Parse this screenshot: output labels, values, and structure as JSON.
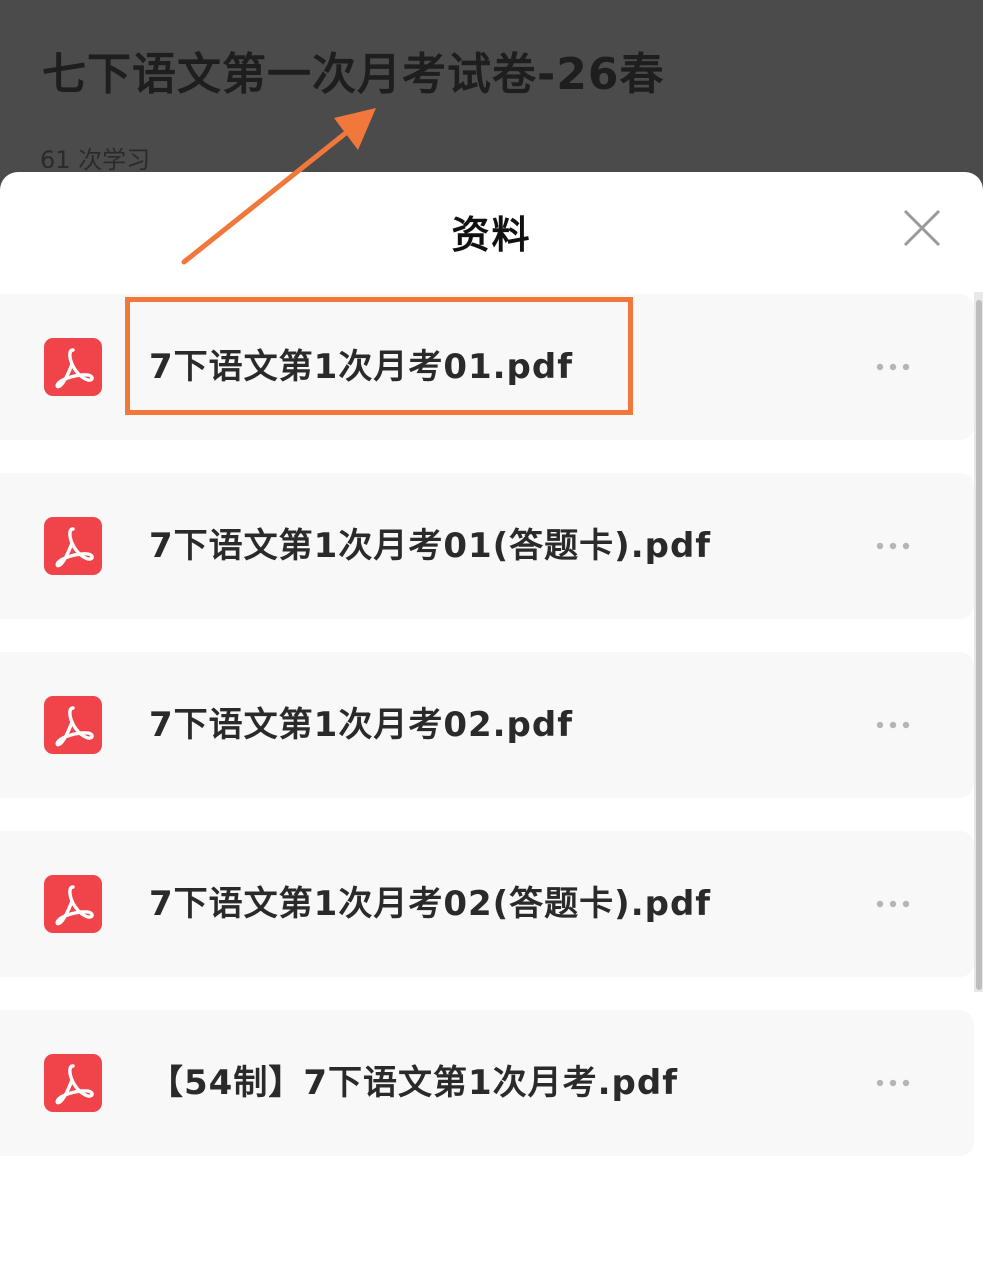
{
  "background_page": {
    "title": "七下语文第一次月考试卷-26春",
    "study_count": "61 次学习"
  },
  "sheet": {
    "title": "资料",
    "close_icon": "close-icon"
  },
  "files": [
    {
      "name": "7下语文第1次月考01.pdf",
      "icon": "pdf-icon",
      "more_icon": "more-icon"
    },
    {
      "name": "7下语文第1次月考01(答题卡).pdf",
      "icon": "pdf-icon",
      "more_icon": "more-icon"
    },
    {
      "name": "7下语文第1次月考02.pdf",
      "icon": "pdf-icon",
      "more_icon": "more-icon"
    },
    {
      "name": "7下语文第1次月考02(答题卡).pdf",
      "icon": "pdf-icon",
      "more_icon": "more-icon"
    },
    {
      "name": "【54制】7下语文第1次月考.pdf",
      "icon": "pdf-icon",
      "more_icon": "more-icon"
    }
  ],
  "colors": {
    "pdf_red": "#f0444a",
    "annotation_orange": "#f2773b",
    "overlay": "#4b4b4b"
  }
}
